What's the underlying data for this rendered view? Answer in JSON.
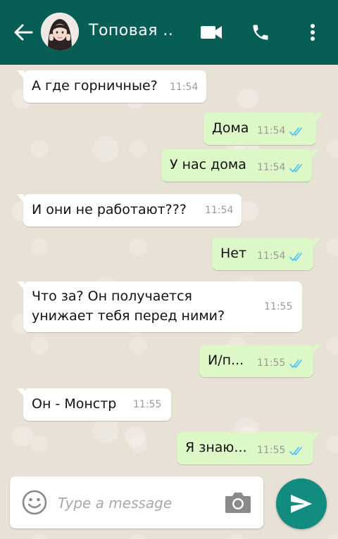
{
  "header": {
    "title": "Топовая ..",
    "back_icon": "arrow-left-icon",
    "video_icon": "video-camera-icon",
    "call_icon": "phone-icon",
    "menu_icon": "more-vert-icon",
    "bg_color": "#075e54"
  },
  "messages": [
    {
      "direction": "in",
      "text": "А где горничные?",
      "time": "11:54"
    },
    {
      "direction": "out",
      "text": "Дома",
      "time": "11:54",
      "read": true
    },
    {
      "direction": "out",
      "text": "У нас дома",
      "time": "11:54",
      "read": true
    },
    {
      "direction": "in",
      "text": "И они не работают???",
      "time": "11:54"
    },
    {
      "direction": "out",
      "text": "Нет",
      "time": "11:54",
      "read": true
    },
    {
      "direction": "in",
      "text_line1": "Что за? Он получается",
      "text_line2": "унижает  тебя перед ними?",
      "time": "11:55"
    },
    {
      "direction": "out",
      "text": "И/п...",
      "time": "11:55",
      "read": true
    },
    {
      "direction": "in",
      "text": "Он  - Монстр",
      "time": "11:55"
    },
    {
      "direction": "out",
      "text": "Я знаю...",
      "time": "11:55",
      "read": true
    }
  ],
  "input": {
    "placeholder": "Type a message",
    "emoji_icon": "smiley-icon",
    "camera_icon": "camera-icon",
    "send_icon": "send-icon"
  },
  "colors": {
    "incoming_bubble": "#ffffff",
    "outgoing_bubble": "#dcf8c6",
    "read_ticks": "#4fc3f7",
    "send_button": "#128c7e"
  }
}
